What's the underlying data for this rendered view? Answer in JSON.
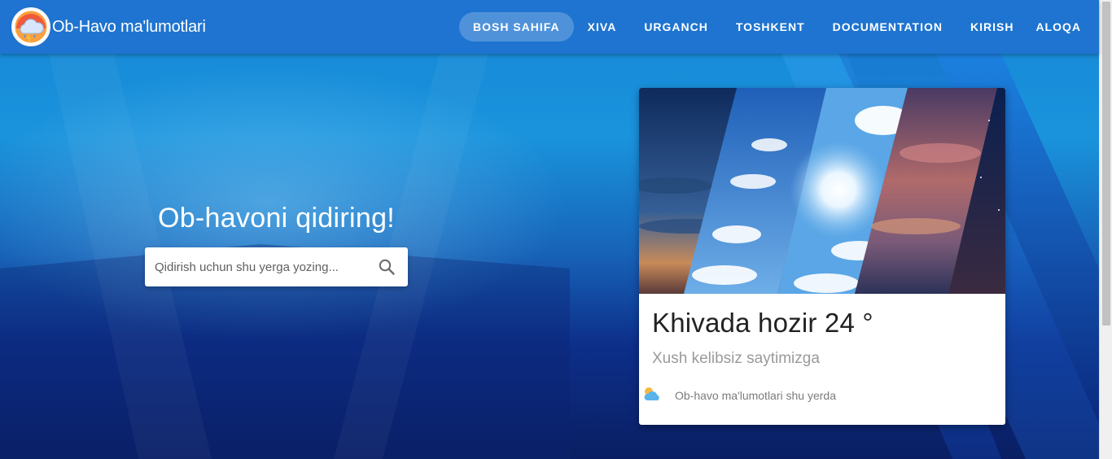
{
  "navbar": {
    "brand_title": "Ob-Havo ma'lumotlari",
    "links": [
      {
        "label": "BOSH SAHIFA",
        "active": true
      },
      {
        "label": "XIVA"
      },
      {
        "label": "URGANCH"
      },
      {
        "label": "TOSHKENT"
      },
      {
        "label": "DOCUMENTATION"
      },
      {
        "label": "KIRISH"
      },
      {
        "label": "ALOQA"
      }
    ]
  },
  "search": {
    "heading": "Ob-havoni qidiring!",
    "placeholder": "Qidirish uchun shu yerga yozing...",
    "icon": "search-icon"
  },
  "card": {
    "title": "Khivada hozir 24 °",
    "subtitle": "Xush kelibsiz saytimizga",
    "footer_text": "Ob-havo ma'lumotlari shu yerda",
    "footer_icon": "partly-cloudy-icon"
  },
  "colors": {
    "navbar": "#1e74d0",
    "accent": "#1687d6"
  }
}
